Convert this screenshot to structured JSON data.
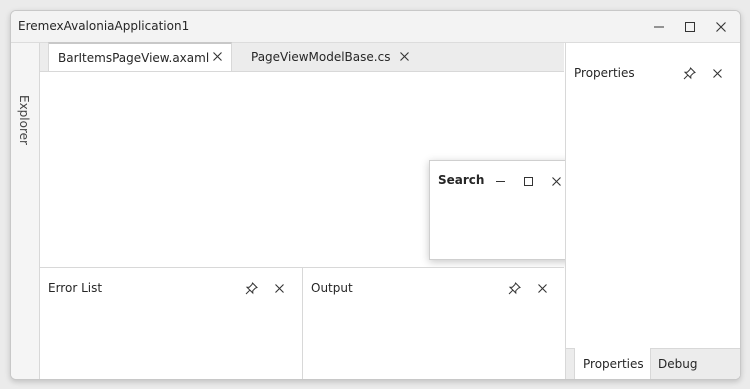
{
  "window": {
    "title": "EremexAvaloniaApplication1"
  },
  "explorer_tab": {
    "label": "Explorer"
  },
  "documents": {
    "tabs": [
      {
        "label": "BarItemsPageView.axaml",
        "active": true
      },
      {
        "label": "PageViewModelBase.cs",
        "active": false
      }
    ]
  },
  "search_window": {
    "title": "Search"
  },
  "bottom_panels": [
    {
      "title": "Error List"
    },
    {
      "title": "Output"
    }
  ],
  "properties_panel": {
    "title": "Properties",
    "bottom_tabs": [
      {
        "label": "Properties",
        "active": true
      },
      {
        "label": "Debug",
        "active": false
      }
    ]
  },
  "icons": {
    "minimize": "minimize-icon",
    "maximize": "maximize-icon",
    "close": "close-icon",
    "pin": "pin-icon"
  },
  "colors": {
    "titlebar": "#f3f3f3",
    "tabstrip": "#ececec",
    "border": "#d8d8d8",
    "text": "#262626"
  }
}
